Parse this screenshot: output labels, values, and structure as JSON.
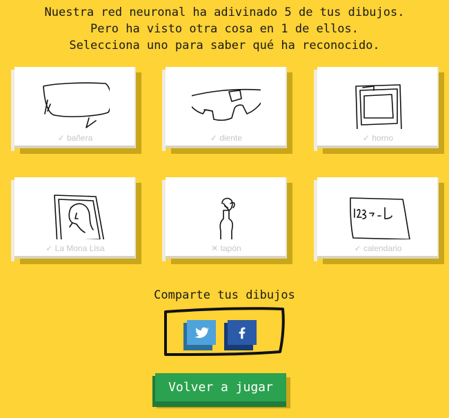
{
  "intro": {
    "line1": "Nuestra red neuronal ha adivinado 5 de tus dibujos.",
    "line2": "Pero ha visto otra cosa en 1 de ellos.",
    "line3": "Selecciona uno para saber qué ha reconocido."
  },
  "drawings": [
    {
      "label": "✓ bañera",
      "icon": "bathtub-drawing",
      "recognized": true
    },
    {
      "label": "✓ diente",
      "icon": "tooth-drawing",
      "recognized": true
    },
    {
      "label": "✓ horno",
      "icon": "oven-drawing",
      "recognized": true
    },
    {
      "label": "✓ La Mona Lisa",
      "icon": "mona-lisa-drawing",
      "recognized": true
    },
    {
      "label": "✕ tapón",
      "icon": "cork-drawing",
      "recognized": false
    },
    {
      "label": "✓ calendario",
      "icon": "calendar-drawing",
      "recognized": true
    }
  ],
  "share": {
    "title": "Comparte tus dibujos",
    "twitter_icon": "twitter-icon",
    "facebook_icon": "facebook-icon"
  },
  "replay_label": "Volver a jugar",
  "colors": {
    "background": "#fdd335",
    "replay_button": "#2aa24f",
    "twitter": "#4fa3dc",
    "facebook": "#2a5aa8"
  }
}
